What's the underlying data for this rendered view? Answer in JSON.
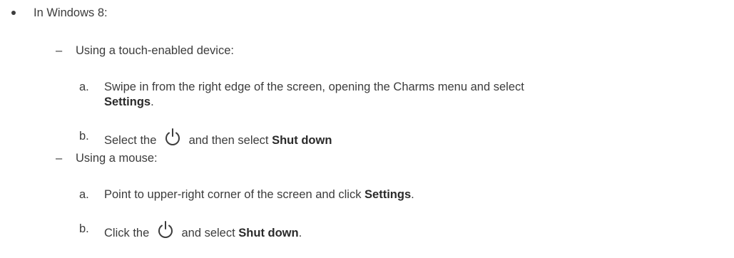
{
  "doc": {
    "l1": {
      "bullet": "•",
      "text": "In Windows 8:"
    },
    "touch": {
      "dash": "–",
      "text": "Using a touch-enabled device:",
      "step_a": {
        "letter": "a.",
        "line1": "Swipe in from the right edge of the screen, opening the Charms menu and select",
        "bold": "Settings",
        "after": "."
      },
      "step_b": {
        "letter": "b.",
        "before": "Select the",
        "icon": "power-icon",
        "middle": "and then select",
        "bold": "Shut down"
      }
    },
    "mouse": {
      "dash": "–",
      "text": "Using a mouse:",
      "step_a": {
        "letter": "a.",
        "before": "Point to upper-right corner of the screen and click",
        "bold": "Settings",
        "after": "."
      },
      "step_b": {
        "letter": "b.",
        "before": "Click the",
        "icon": "power-icon",
        "middle": "and select",
        "bold": "Shut down",
        "after": "."
      }
    }
  }
}
